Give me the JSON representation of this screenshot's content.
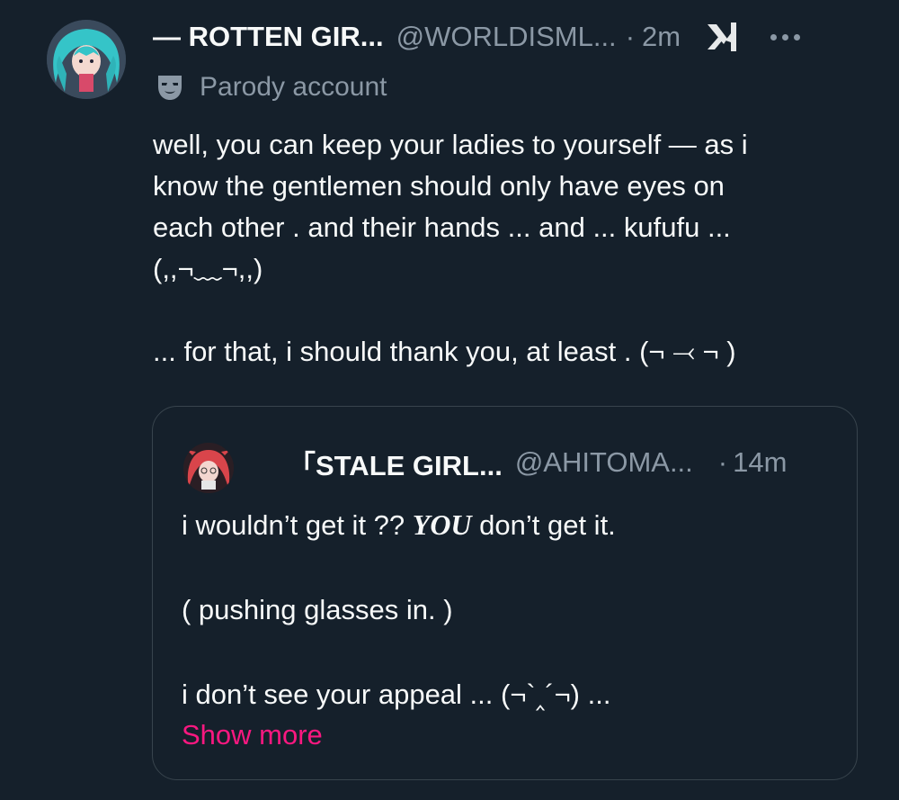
{
  "tweet": {
    "display_name": "— ROTTEN GIR...",
    "handle": "@WORLDISML...",
    "separator": "·",
    "time": "2m",
    "label": "Parody account",
    "lines": [
      "well, you can keep your ladies to yourself — as i",
      "know the gentlemen should only have eyes on",
      "each other . and their hands ... and ... kufufu ...",
      "(,,¬﹏¬,,)",
      "... for that, i should thank you, at least . (¬ ⤙ ¬ )"
    ],
    "icons": {
      "grok": "grok-icon",
      "more": "more-options-icon",
      "label": "parody-mask-icon"
    }
  },
  "quote": {
    "display_name": "「STALE GIRL...",
    "handle": "@AHITOMA...",
    "separator": "·",
    "time": "14m",
    "line1_before": "i wouldn’t get it ?? ",
    "line1_emph": "YOU",
    "line1_after": " don’t get it.",
    "line2": "( pushing glasses in. )",
    "line3": "i don’t see your appeal ... (¬`‸´¬) ...",
    "show_more": "Show more",
    "accent_color": "#f91880"
  },
  "colors": {
    "background": "#15202b",
    "text": "#f7f9f9",
    "secondary": "#8b98a5",
    "border": "#38444d"
  }
}
